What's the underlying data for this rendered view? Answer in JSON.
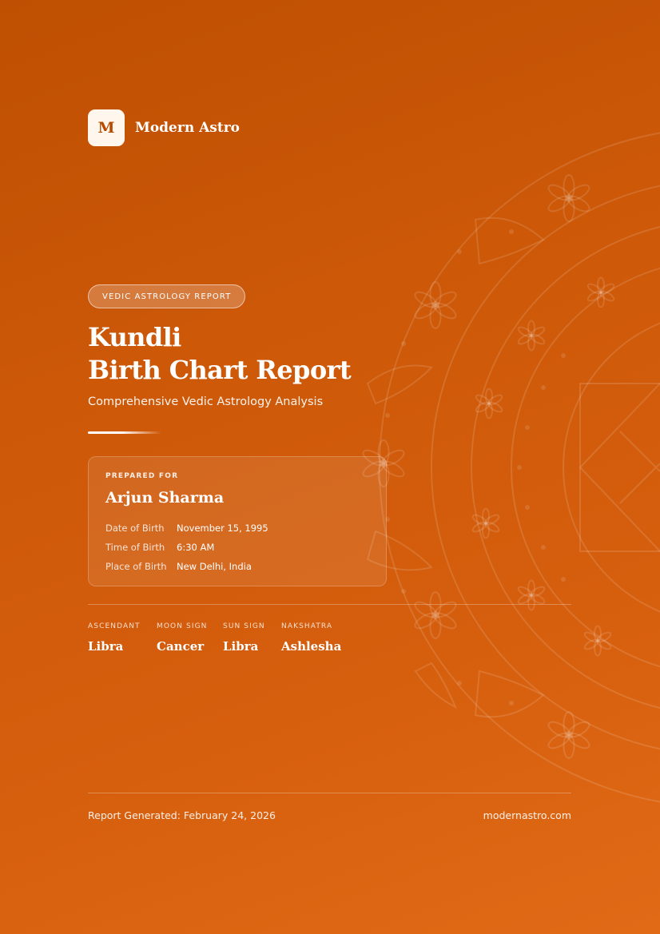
{
  "brand": {
    "mark": "M",
    "name": "Modern Astro",
    "logo_icon": "monogram-m-icon"
  },
  "badge": "VEDIC ASTROLOGY REPORT",
  "title": {
    "line1": "Kundli",
    "line2": "Birth Chart Report"
  },
  "subtitle": "Comprehensive Vedic Astrology Analysis",
  "prepared": {
    "label": "PREPARED FOR",
    "name": "Arjun Sharma",
    "details": [
      {
        "key": "Date of Birth",
        "value": "November 15, 1995"
      },
      {
        "key": "Time of Birth",
        "value": "6:30 AM"
      },
      {
        "key": "Place of Birth",
        "value": "New Delhi, India"
      }
    ]
  },
  "signs": [
    {
      "label": "ASCENDANT",
      "value": "Libra"
    },
    {
      "label": "MOON SIGN",
      "value": "Cancer"
    },
    {
      "label": "SUN SIGN",
      "value": "Libra"
    },
    {
      "label": "NAKSHATRA",
      "value": "Ashlesha"
    }
  ],
  "footer": {
    "generated": "Report Generated: February 24, 2026",
    "website": "modernastro.com"
  },
  "colors": {
    "background_start": "#bf4f02",
    "background_end": "#e06a16",
    "logo_tile": "#fff7ee",
    "logo_letter": "#b84a00",
    "text": "#ffffff"
  },
  "decoration": {
    "background_icon": "mandala-ornament-icon"
  }
}
